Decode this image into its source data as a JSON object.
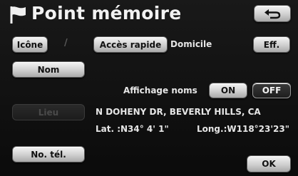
{
  "header": {
    "title": "Point mémoire",
    "back_icon": "return-arrow-icon",
    "flag_icon": "flag-icon"
  },
  "toolbar": {
    "icon_label": "Icône",
    "separator": "/",
    "quick_access_label": "Accès rapide",
    "quick_access_value": "Domicile",
    "delete_label": "Eff."
  },
  "name": {
    "button_label": "Nom"
  },
  "display_names": {
    "label": "Affichage noms",
    "on_label": "ON",
    "off_label": "OFF",
    "selected": "ON"
  },
  "location": {
    "button_label": "Lieu",
    "address": "N DOHENY DR, BEVERLY HILLS, CA",
    "lat": "Lat. :N34° 4' 1\"",
    "long": "Long.:W118°23'23\""
  },
  "phone": {
    "button_label": "No. tél."
  },
  "footer": {
    "ok_label": "OK"
  }
}
